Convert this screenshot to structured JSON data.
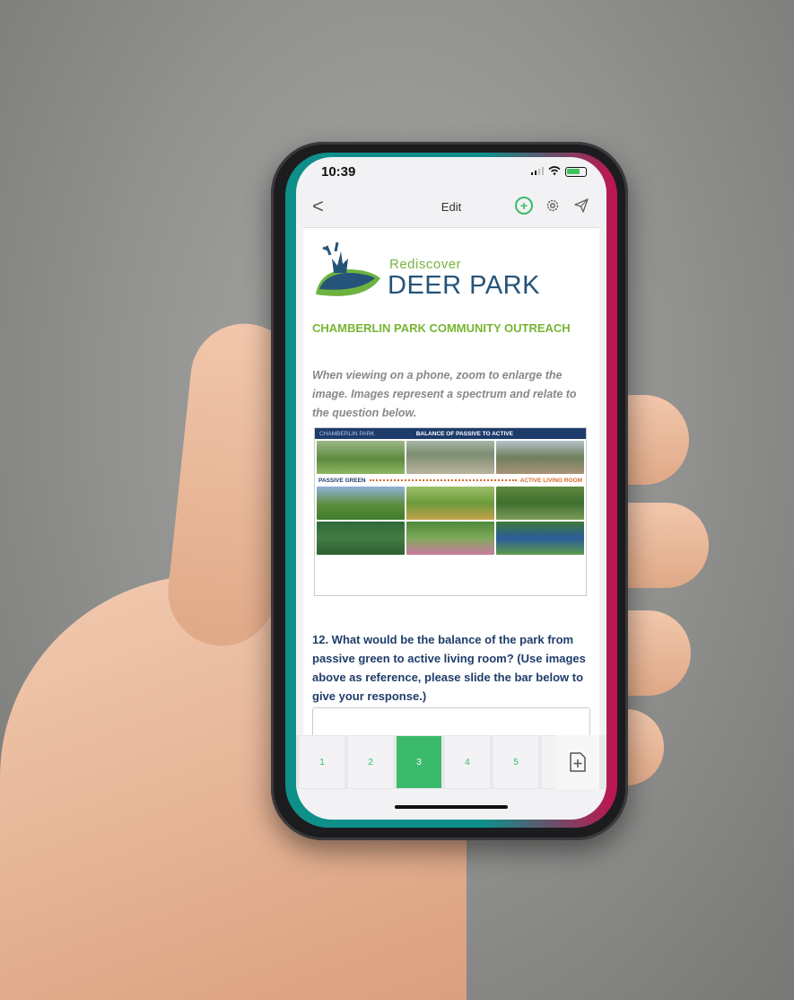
{
  "status": {
    "time": "10:39"
  },
  "nav": {
    "back": "<",
    "title": "Edit",
    "icons": [
      "add-circle-icon",
      "gear-icon",
      "send-icon"
    ]
  },
  "logo": {
    "small": "Rediscover",
    "big": "DEER PARK"
  },
  "section_title": "CHAMBERLIN PARK COMMUNITY OUTREACH",
  "instructions": "When viewing on a phone, zoom to enlarge the image.  Images represent a spectrum and relate to the question below.",
  "board": {
    "header_left": "CHAMBERLIN PARK",
    "header_center": "BALANCE OF PASSIVE TO ACTIVE",
    "spectrum_left": "PASSIVE GREEN",
    "spectrum_right": "ACTIVE LIVING ROOM"
  },
  "question": "12. What would be the balance of the park from passive green to active living room? (Use images above as reference, please slide the bar below to give your response.)",
  "pager": {
    "pages": [
      "1",
      "2",
      "3",
      "4",
      "5"
    ],
    "active": "3"
  },
  "colors": {
    "accent_green": "#3cba6b",
    "title_green": "#77b534",
    "navy": "#1f3d6a"
  }
}
